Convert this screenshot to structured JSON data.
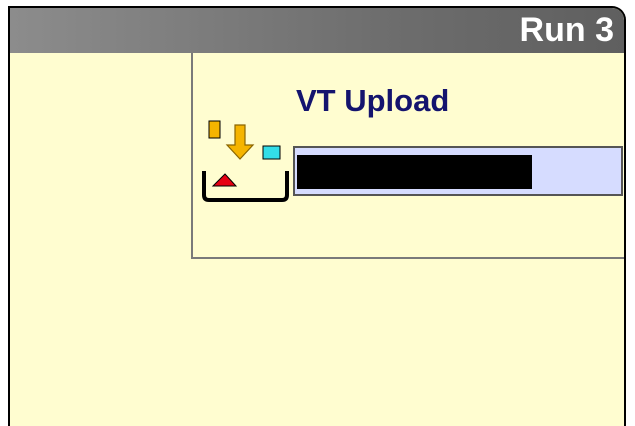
{
  "header": {
    "run_label": "Run 3"
  },
  "dialog": {
    "title": "VT Upload",
    "icon": "upload-to-tray-icon",
    "progress_fraction": 0.73
  },
  "colors": {
    "panel_background": "#fffdd0",
    "title_bar": "#6e6e6e",
    "dialog_title": "#14146e",
    "progress_track": "#d6dcff",
    "progress_fill": "#000000"
  }
}
